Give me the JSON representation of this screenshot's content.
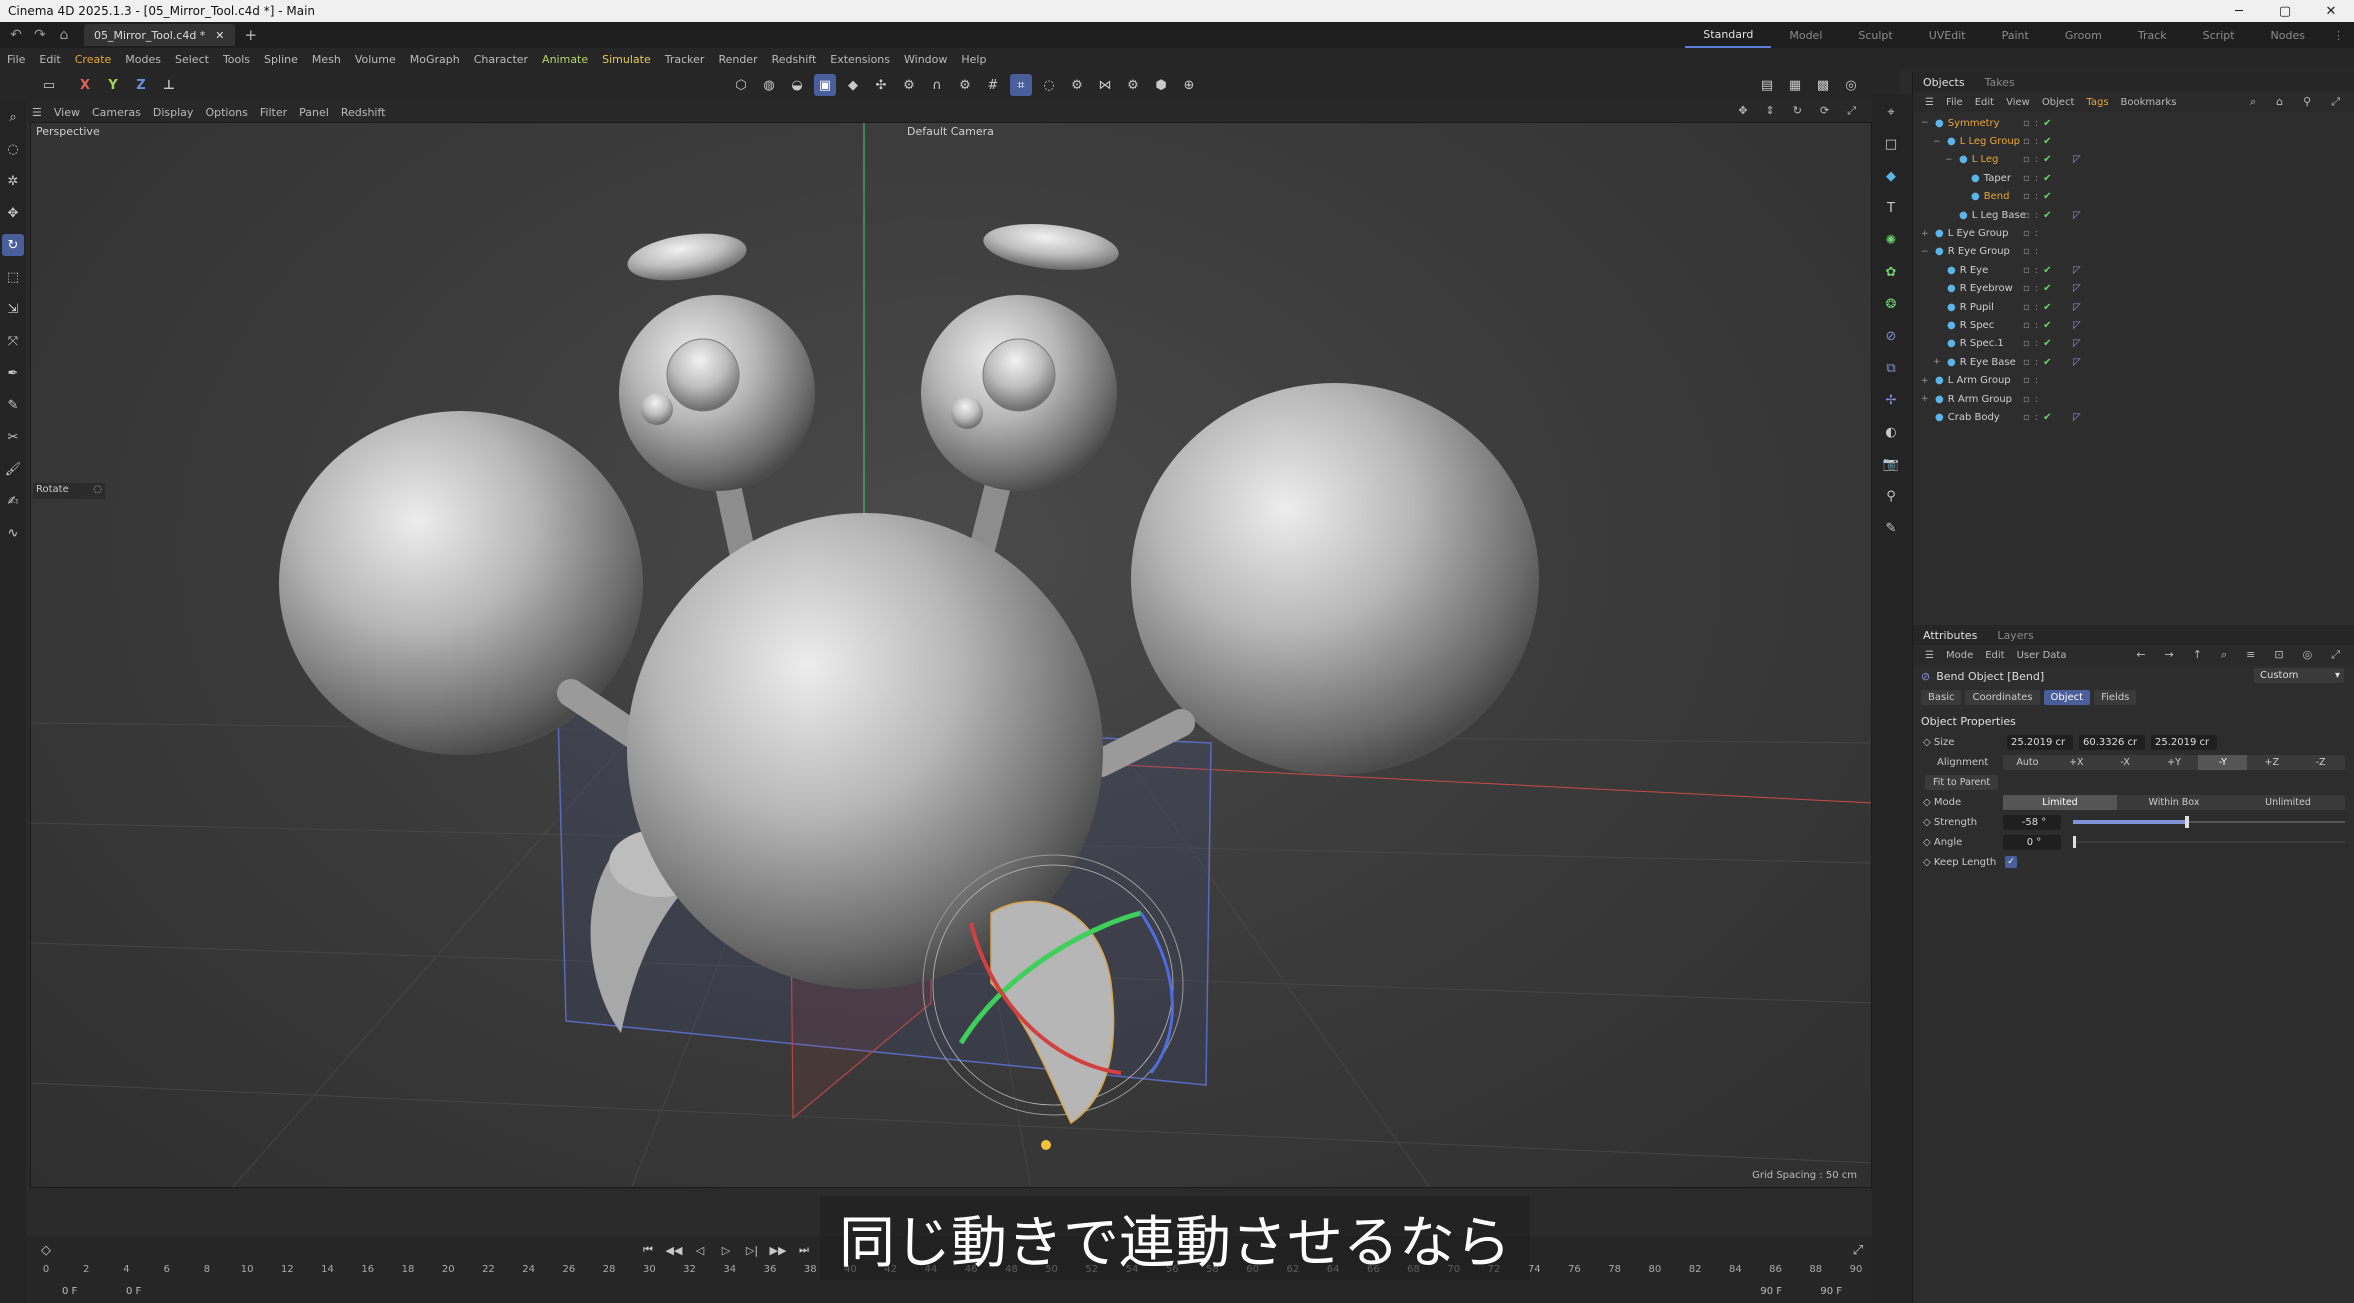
{
  "window": {
    "title": "Cinema 4D 2025.1.3 - [05_Mirror_Tool.c4d *] - Main",
    "controls": [
      "─",
      "▢",
      "✕"
    ]
  },
  "tabbar": {
    "doc_tab": "05_Mirror_Tool.c4d *",
    "close": "✕",
    "new": "+",
    "layouts": [
      "Standard",
      "Model",
      "Sculpt",
      "UVEdit",
      "Paint",
      "Groom",
      "Track",
      "Script",
      "Nodes"
    ],
    "active_layout": "Standard"
  },
  "menubar": [
    "File",
    "Edit",
    "Create",
    "Modes",
    "Select",
    "Tools",
    "Spline",
    "Mesh",
    "Volume",
    "MoGraph",
    "Character",
    "Animate",
    "Simulate",
    "Tracker",
    "Render",
    "Redshift",
    "Extensions",
    "Window",
    "Help"
  ],
  "toolbar": {
    "axes": [
      "X",
      "Y",
      "Z"
    ]
  },
  "viewport": {
    "menu": [
      "View",
      "Cameras",
      "Display",
      "Options",
      "Filter",
      "Panel",
      "Redshift"
    ],
    "label": "Perspective",
    "camera": "Default Camera",
    "grid_spacing": "Grid Spacing : 50 cm",
    "tool_label": "Rotate"
  },
  "subtitle": "同じ動きで連動させるなら",
  "timeline": {
    "ticks": [
      "0",
      "2",
      "4",
      "6",
      "8",
      "10",
      "12",
      "14",
      "16",
      "18",
      "20",
      "22",
      "24",
      "26",
      "28",
      "30",
      "32",
      "34",
      "36",
      "38",
      "40",
      "42",
      "44",
      "46",
      "48",
      "50",
      "52",
      "54",
      "56",
      "58",
      "60",
      "62",
      "64",
      "66",
      "68",
      "70",
      "72",
      "74",
      "76",
      "78",
      "80",
      "82",
      "84",
      "86",
      "88",
      "90"
    ],
    "start": "0 F",
    "current": "0 F",
    "end": "90 F",
    "end2": "90 F"
  },
  "objects_panel": {
    "tabs": [
      "Objects",
      "Takes"
    ],
    "menu": [
      "File",
      "Edit",
      "View",
      "Object",
      "Tags",
      "Bookmarks"
    ],
    "items": [
      {
        "name": "Symmetry",
        "indent": 0,
        "selected": true,
        "checks": true,
        "tag": false,
        "expanded": "−"
      },
      {
        "name": "L Leg Group",
        "indent": 1,
        "selected": true,
        "checks": true,
        "tag": false,
        "expanded": "−"
      },
      {
        "name": "L Leg",
        "indent": 2,
        "selected": true,
        "checks": true,
        "tag": true,
        "expanded": "−"
      },
      {
        "name": "Taper",
        "indent": 3,
        "selected": false,
        "checks": true,
        "tag": false,
        "expanded": ""
      },
      {
        "name": "Bend",
        "indent": 3,
        "selected": true,
        "checks": true,
        "tag": false,
        "expanded": ""
      },
      {
        "name": "L Leg Base",
        "indent": 2,
        "selected": false,
        "checks": true,
        "tag": true,
        "expanded": ""
      },
      {
        "name": "L Eye Group",
        "indent": 0,
        "selected": false,
        "checks": false,
        "tag": false,
        "expanded": "+"
      },
      {
        "name": "R Eye Group",
        "indent": 0,
        "selected": false,
        "checks": false,
        "tag": false,
        "expanded": "−"
      },
      {
        "name": "R Eye",
        "indent": 1,
        "selected": false,
        "checks": true,
        "tag": true,
        "expanded": ""
      },
      {
        "name": "R Eyebrow",
        "indent": 1,
        "selected": false,
        "checks": true,
        "tag": true,
        "expanded": ""
      },
      {
        "name": "R Pupil",
        "indent": 1,
        "selected": false,
        "checks": true,
        "tag": true,
        "expanded": ""
      },
      {
        "name": "R Spec",
        "indent": 1,
        "selected": false,
        "checks": true,
        "tag": true,
        "expanded": ""
      },
      {
        "name": "R Spec.1",
        "indent": 1,
        "selected": false,
        "checks": true,
        "tag": true,
        "expanded": ""
      },
      {
        "name": "R Eye Base",
        "indent": 1,
        "selected": false,
        "checks": true,
        "tag": true,
        "expanded": "+"
      },
      {
        "name": "L Arm Group",
        "indent": 0,
        "selected": false,
        "checks": false,
        "tag": false,
        "expanded": "+"
      },
      {
        "name": "R Arm Group",
        "indent": 0,
        "selected": false,
        "checks": false,
        "tag": false,
        "expanded": "+"
      },
      {
        "name": "Crab Body",
        "indent": 0,
        "selected": false,
        "checks": true,
        "tag": true,
        "expanded": ""
      }
    ]
  },
  "attributes_panel": {
    "tabs": [
      "Attributes",
      "Layers"
    ],
    "menu": [
      "Mode",
      "Edit",
      "User Data"
    ],
    "object_title": "Bend Object [Bend]",
    "preset": "Custom",
    "subtabs": [
      "Basic",
      "Coordinates",
      "Object",
      "Fields"
    ],
    "active_subtab": "Object",
    "section": "Object Properties",
    "size_label": "Size",
    "size": [
      "25.2019 cr",
      "60.3326 cr",
      "25.2019 cr"
    ],
    "alignment_label": "Alignment",
    "alignment_options": [
      "Auto",
      "+X",
      "-X",
      "+Y",
      "-Y",
      "+Z",
      "-Z"
    ],
    "alignment_selected": "-Y",
    "fit_to_parent": "Fit to Parent",
    "mode_label": "Mode",
    "mode_options": [
      "Limited",
      "Within Box",
      "Unlimited"
    ],
    "mode_selected": "Limited",
    "strength_label": "Strength",
    "strength_value": "-58 °",
    "strength_fraction": 0.42,
    "angle_label": "Angle",
    "angle_value": "0 °",
    "keep_length_label": "Keep Length",
    "keep_length": "✓"
  },
  "colors": {
    "accent": "#4a5e9c",
    "selected_text": "#e8a73a",
    "check_green": "#6bd16b"
  }
}
